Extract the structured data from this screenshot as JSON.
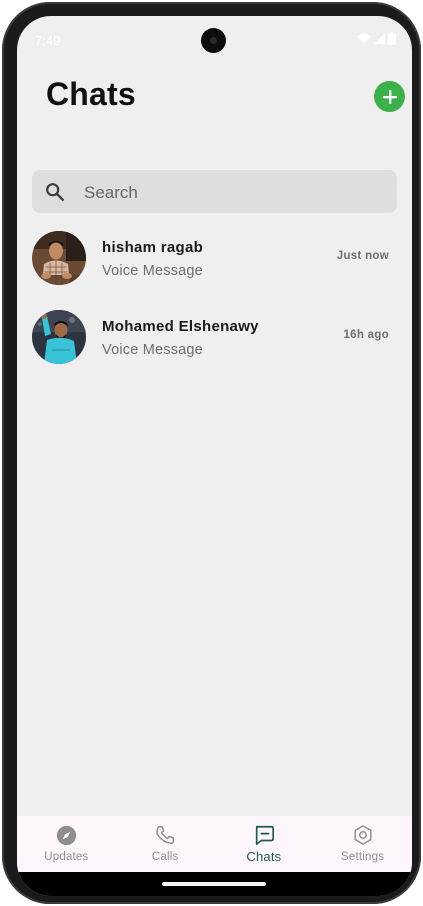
{
  "status_bar": {
    "time": "7:49"
  },
  "header": {
    "title": "Chats"
  },
  "search": {
    "placeholder": "Search"
  },
  "chats": [
    {
      "name": "hisham ragab",
      "preview": "Voice Message",
      "time": "Just now"
    },
    {
      "name": "Mohamed Elshenawy",
      "preview": "Voice Message",
      "time": "16h ago"
    }
  ],
  "bottom_nav": [
    {
      "label": "Updates",
      "icon": "compass-icon",
      "active": false
    },
    {
      "label": "Calls",
      "icon": "phone-icon",
      "active": false
    },
    {
      "label": "Chats",
      "icon": "chat-bubble-icon",
      "active": true
    },
    {
      "label": "Settings",
      "icon": "gear-icon",
      "active": false
    }
  ],
  "colors": {
    "accent_green": "#3bb14a",
    "active_tab": "#1c5b4f",
    "background": "#efefef",
    "search_bg": "#dedede"
  }
}
